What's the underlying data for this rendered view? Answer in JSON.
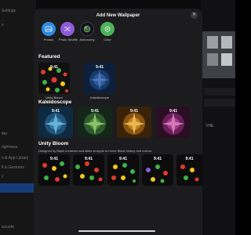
{
  "background": {
    "sidebar_items": [
      "Settings",
      "s",
      "",
      "",
      "",
      "",
      "",
      "",
      "",
      "",
      "tter",
      "rightness",
      "n & App Library",
      "r",
      "s & Gestures",
      "y",
      "",
      "",
      "",
      "",
      "",
      "",
      "",
      "",
      "sscode"
    ],
    "right_text": "VHE"
  },
  "sheet": {
    "title": "Add New Wallpaper",
    "close_icon": "close-icon",
    "quick_actions": [
      {
        "label": "Photos",
        "icon": "photos-icon",
        "color": "#2f8ae0"
      },
      {
        "label": "Photo Shuffle",
        "icon": "shuffle-icon",
        "color": "#8e5bd8"
      },
      {
        "label": "Astronomy",
        "icon": "astronomy-icon",
        "color": "#1a1a2e"
      },
      {
        "label": "Color",
        "icon": "color-icon",
        "color": "#4db35a"
      }
    ],
    "featured": {
      "title": "Featured",
      "items": [
        {
          "caption": "Unity Bloom",
          "time": "9:41"
        },
        {
          "caption": "Kaleidoscope",
          "time": "9:41"
        }
      ]
    },
    "kaleidoscope": {
      "title": "Kaleidoscope",
      "times": [
        "9:41",
        "9:41",
        "9:41",
        "9:41"
      ]
    },
    "unity_bloom": {
      "title": "Unity Bloom",
      "description": "Designed by Black creatives and allies at Apple to honor Black history and culture.",
      "times": [
        "9:41",
        "9:41",
        "9:41",
        "9:41",
        "9:41"
      ]
    }
  }
}
